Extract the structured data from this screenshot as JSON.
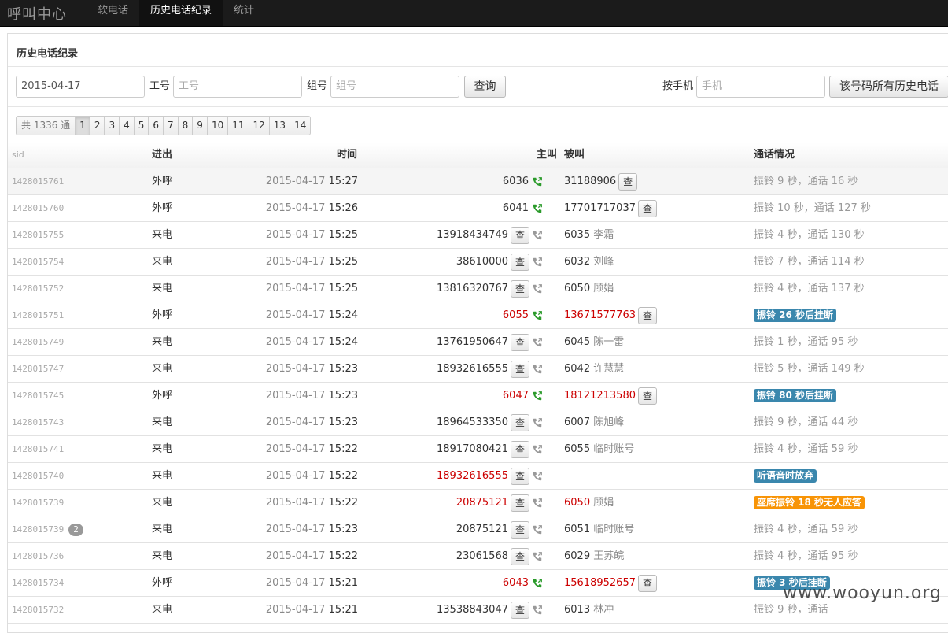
{
  "brand": "呼叫中心",
  "nav": [
    "软电话",
    "历史电话纪录",
    "统计"
  ],
  "panel_title": "历史电话纪录",
  "form": {
    "date_value": "2015-04-17",
    "worker_label": "工号",
    "worker_placeholder": "工号",
    "group_label": "组号",
    "group_placeholder": "组号",
    "query_button": "查询",
    "mobile_label": "按手机",
    "mobile_placeholder": "手机",
    "history_button": "该号码所有历史电话"
  },
  "pager": {
    "total": "共 1336 通",
    "pages": [
      "1",
      "2",
      "3",
      "4",
      "5",
      "6",
      "7",
      "8",
      "9",
      "10",
      "11",
      "12",
      "13",
      "14"
    ],
    "active": "1"
  },
  "columns": {
    "sid": "sid",
    "dir": "进出",
    "time": "时间",
    "caller": "主叫",
    "callee": "被叫",
    "status": "通话情况"
  },
  "check_label": "查",
  "rows": [
    {
      "sid": "1428015761",
      "dir": "外呼",
      "date": "2015-04-17",
      "time": "15:27",
      "caller": "6036",
      "caller_btn": false,
      "outgoing": true,
      "callee": "31188906",
      "callee_btn": true,
      "red": false,
      "status": "振铃 9 秒，通话 16 秒",
      "status_label": null
    },
    {
      "sid": "1428015760",
      "dir": "外呼",
      "date": "2015-04-17",
      "time": "15:26",
      "caller": "6041",
      "caller_btn": false,
      "outgoing": true,
      "callee": "17701717037",
      "callee_btn": true,
      "red": false,
      "status": "振铃 10 秒，通话 127 秒",
      "status_label": null
    },
    {
      "sid": "1428015755",
      "dir": "来电",
      "date": "2015-04-17",
      "time": "15:25",
      "caller": "13918434749",
      "caller_btn": true,
      "outgoing": false,
      "callee": "6035 李霜",
      "callee_btn": false,
      "red": false,
      "status": "振铃 4 秒，通话 130 秒",
      "status_label": null
    },
    {
      "sid": "1428015754",
      "dir": "来电",
      "date": "2015-04-17",
      "time": "15:25",
      "caller": "38610000",
      "caller_btn": true,
      "outgoing": false,
      "callee": "6032 刘峰",
      "callee_btn": false,
      "red": false,
      "status": "振铃 7 秒，通话 114 秒",
      "status_label": null
    },
    {
      "sid": "1428015752",
      "dir": "来电",
      "date": "2015-04-17",
      "time": "15:25",
      "caller": "13816320767",
      "caller_btn": true,
      "outgoing": false,
      "callee": "6050 顾娟",
      "callee_btn": false,
      "red": false,
      "status": "振铃 4 秒，通话 137 秒",
      "status_label": null
    },
    {
      "sid": "1428015751",
      "dir": "外呼",
      "date": "2015-04-17",
      "time": "15:24",
      "caller": "6055",
      "caller_btn": false,
      "outgoing": true,
      "callee": "13671577763",
      "callee_btn": true,
      "red": true,
      "status": "",
      "status_label": {
        "text": "振铃 26 秒后挂断",
        "type": "info"
      }
    },
    {
      "sid": "1428015749",
      "dir": "来电",
      "date": "2015-04-17",
      "time": "15:24",
      "caller": "13761950647",
      "caller_btn": true,
      "outgoing": false,
      "callee": "6045 陈一雷",
      "callee_btn": false,
      "red": false,
      "status": "振铃 1 秒，通话 95 秒",
      "status_label": null
    },
    {
      "sid": "1428015747",
      "dir": "来电",
      "date": "2015-04-17",
      "time": "15:23",
      "caller": "18932616555",
      "caller_btn": true,
      "outgoing": false,
      "callee": "6042 许慧慧",
      "callee_btn": false,
      "red": false,
      "status": "振铃 5 秒，通话 149 秒",
      "status_label": null
    },
    {
      "sid": "1428015745",
      "dir": "外呼",
      "date": "2015-04-17",
      "time": "15:23",
      "caller": "6047",
      "caller_btn": false,
      "outgoing": true,
      "callee": "18121213580",
      "callee_btn": true,
      "red": true,
      "status": "",
      "status_label": {
        "text": "振铃 80 秒后挂断",
        "type": "info"
      }
    },
    {
      "sid": "1428015743",
      "dir": "来电",
      "date": "2015-04-17",
      "time": "15:23",
      "caller": "18964533350",
      "caller_btn": true,
      "outgoing": false,
      "callee": "6007 陈旭峰",
      "callee_btn": false,
      "red": false,
      "status": "振铃 9 秒，通话 44 秒",
      "status_label": null
    },
    {
      "sid": "1428015741",
      "dir": "来电",
      "date": "2015-04-17",
      "time": "15:22",
      "caller": "18917080421",
      "caller_btn": true,
      "outgoing": false,
      "callee": "6055 临时账号",
      "callee_btn": false,
      "red": false,
      "status": "振铃 4 秒，通话 59 秒",
      "status_label": null
    },
    {
      "sid": "1428015740",
      "dir": "来电",
      "date": "2015-04-17",
      "time": "15:22",
      "caller": "18932616555",
      "caller_btn": true,
      "outgoing": false,
      "callee": "",
      "callee_btn": false,
      "red": true,
      "status": "",
      "status_label": {
        "text": "听语音时放弃",
        "type": "info"
      }
    },
    {
      "sid": "1428015739",
      "dir": "来电",
      "date": "2015-04-17",
      "time": "15:22",
      "caller": "20875121",
      "caller_btn": true,
      "outgoing": false,
      "callee": "6050 顾娟",
      "callee_btn": false,
      "red": true,
      "status": "",
      "status_label": {
        "text": "座席振铃 18 秒无人应答",
        "type": "warn"
      }
    },
    {
      "sid": "1428015739",
      "badge": "2",
      "dir": "来电",
      "date": "2015-04-17",
      "time": "15:23",
      "caller": "20875121",
      "caller_btn": true,
      "outgoing": false,
      "callee": "6051 临时账号",
      "callee_btn": false,
      "red": false,
      "status": "振铃 4 秒，通话 59 秒",
      "status_label": null
    },
    {
      "sid": "1428015736",
      "dir": "来电",
      "date": "2015-04-17",
      "time": "15:22",
      "caller": "23061568",
      "caller_btn": true,
      "outgoing": false,
      "callee": "6029 王苏皖",
      "callee_btn": false,
      "red": false,
      "status": "振铃 4 秒，通话 95 秒",
      "status_label": null
    },
    {
      "sid": "1428015734",
      "dir": "外呼",
      "date": "2015-04-17",
      "time": "15:21",
      "caller": "6043",
      "caller_btn": false,
      "outgoing": true,
      "callee": "15618952657",
      "callee_btn": true,
      "red": true,
      "status": "",
      "status_label": {
        "text": "振铃 3 秒后挂断",
        "type": "info"
      }
    },
    {
      "sid": "1428015732",
      "dir": "来电",
      "date": "2015-04-17",
      "time": "15:21",
      "caller": "13538843047",
      "caller_btn": true,
      "outgoing": false,
      "callee": "6013 林冲",
      "callee_btn": false,
      "red": false,
      "status": "振铃 9 秒，通话",
      "status_label": null
    }
  ],
  "watermark": "www.wooyun.org",
  "colors": {
    "outgoing_icon": "#2a9a2a",
    "incoming_icon": "#999999",
    "alert_red": "#cc0000",
    "label_info": "#3a87ad",
    "label_warn": "#f89406"
  }
}
